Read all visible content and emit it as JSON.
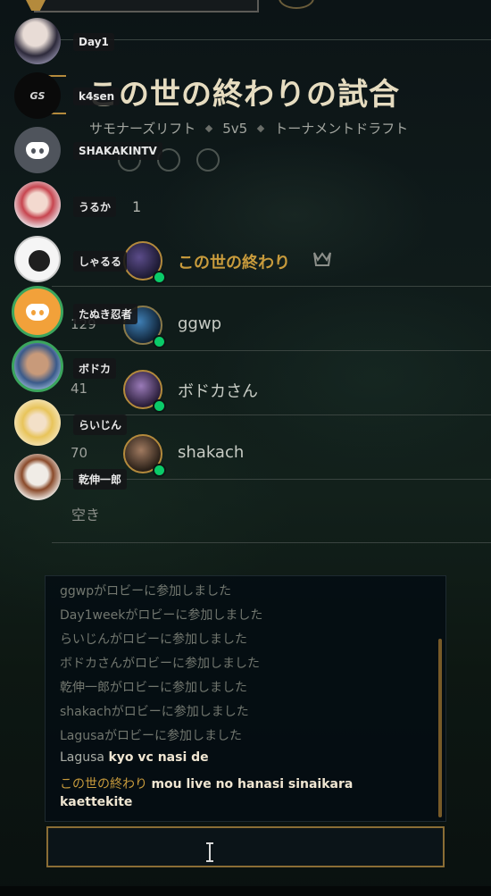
{
  "lobby": {
    "title": "この世の終わりの試合",
    "subtitle_map": "サモナーズリフト",
    "subtitle_size": "5v5",
    "subtitle_mode": "トーナメントドラフト",
    "team_count": "1"
  },
  "players": [
    {
      "level": "",
      "name": "この世の終わり",
      "owner": true,
      "online": true
    },
    {
      "level": "129",
      "name": "ggwp",
      "online": true
    },
    {
      "level": "41",
      "name": "ボドカさん",
      "online": true
    },
    {
      "level": "70",
      "name": "shakach",
      "online": true
    }
  ],
  "empty_slot": "空き",
  "voice_overlay": [
    {
      "name": "Day1",
      "avatar": "photo"
    },
    {
      "name": "k4sen",
      "avatar": "logo"
    },
    {
      "name": "SHAKAKINTV",
      "avatar": "discord-gray"
    },
    {
      "name": "うるか",
      "avatar": "anime"
    },
    {
      "name": "しゃるる",
      "avatar": "penguin"
    },
    {
      "name": "たぬき忍者",
      "avatar": "discord-orange",
      "speaking": true
    },
    {
      "name": "ボドカ",
      "avatar": "photo",
      "speaking": true
    },
    {
      "name": "らいじん",
      "avatar": "anime"
    },
    {
      "name": "乾伸一郎",
      "avatar": "sketch"
    }
  ],
  "chat": {
    "system_lines": [
      "ggwpがロビーに参加しました",
      "Day1weekがロビーに参加しました",
      "らいじんがロビーに参加しました",
      "ボドカさんがロビーに参加しました",
      "乾伸一郎がロビーに参加しました",
      "shakachがロビーに参加しました",
      "Lagusaがロビーに参加しました"
    ],
    "messages": [
      {
        "user": "Lagusa",
        "text": "kyo vc nasi de"
      },
      {
        "user": "この世の終わり",
        "text": "mou live no hanasi sinaikara",
        "text2": "kaettekite"
      }
    ],
    "input_value": ""
  },
  "colors": {
    "gold": "#c89b3c",
    "online": "#0acb69",
    "discord_blurple": "#5865f2",
    "speaking_ring": "#3ba55d"
  }
}
